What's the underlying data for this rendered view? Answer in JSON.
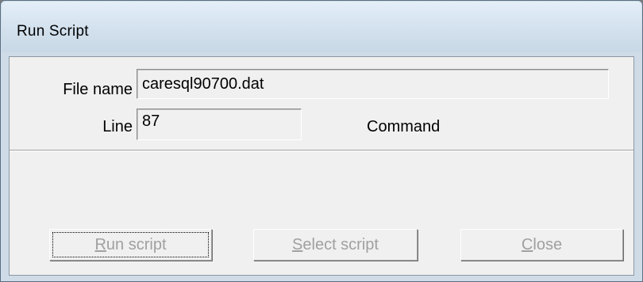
{
  "window": {
    "title": "Run Script"
  },
  "form": {
    "file_label": "File name",
    "file_value": "caresql90700.dat",
    "line_label": "Line",
    "line_value": "87",
    "command_label": "Command"
  },
  "buttons": {
    "run": {
      "mnemonic": "R",
      "rest": "un script",
      "enabled": false
    },
    "select": {
      "mnemonic": "S",
      "rest": "elect script",
      "enabled": false
    },
    "close": {
      "mnemonic": "C",
      "rest": "lose",
      "enabled": false
    }
  },
  "colors": {
    "titlebar": "#d3e1ee",
    "client_background": "#f0f0f0",
    "disabled_text": "#a0a0a0"
  }
}
